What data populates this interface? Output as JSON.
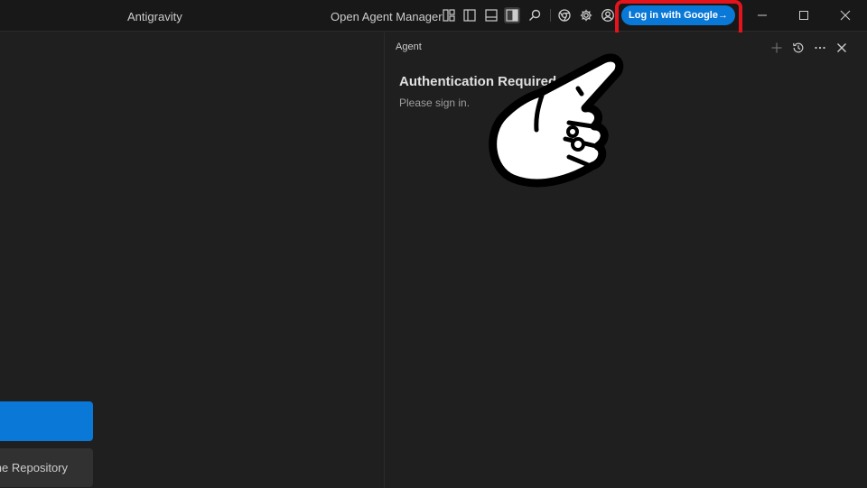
{
  "titlebar": {
    "app_title": "Antigravity",
    "agent_manager_label": "Open Agent Manager",
    "icons": [
      "layout-customize-icon",
      "toggle-primary-sidebar-icon",
      "toggle-panel-icon",
      "toggle-secondary-sidebar-icon",
      "search-icon",
      "chrome-icon",
      "gear-icon",
      "account-icon"
    ],
    "login_button_label": "Log in with Google→",
    "window_controls": [
      "minimize-icon",
      "maximize-icon",
      "close-icon"
    ]
  },
  "editor": {
    "secondary_button_label": "Clone Repository"
  },
  "agent_panel": {
    "header": "Agent",
    "icons": [
      "plus-icon",
      "history-icon",
      "more-icon",
      "close-icon"
    ],
    "auth_title": "Authentication Required",
    "auth_subtitle": "Please sign in."
  },
  "colors": {
    "accent": "#0a78d7",
    "highlight": "#e5141c",
    "background": "#1f1f1f",
    "titlebar": "#181818"
  }
}
